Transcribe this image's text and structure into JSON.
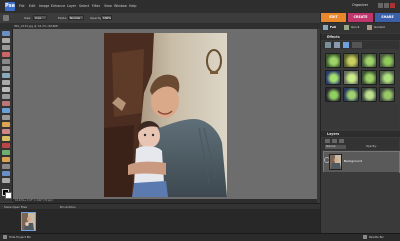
{
  "menubar": {
    "items": [
      "File",
      "Edit",
      "Image",
      "Enhance",
      "Layer",
      "Select",
      "Filter",
      "View",
      "Window",
      "Help"
    ],
    "organizer": "Organizer"
  },
  "options": {
    "size_label": "Size:",
    "size_value": "2 px",
    "mode_label": "Mode:",
    "mode_value": "Normal",
    "opacity_label": "Opacity:",
    "opacity_value": "100%"
  },
  "tabs": {
    "edit": "EDIT",
    "create": "CREATE",
    "share": "SHARE"
  },
  "subtabs": {
    "full": "Full",
    "quick": "Quick",
    "guided": "Guided"
  },
  "document": {
    "tab_title": "IMG_0134.jpg @ 16.4% (RGB/8)"
  },
  "status": {
    "text": "16.42% ▸ 3.47\" x 4.62\" (72 ppi)"
  },
  "bin": {
    "show_open_files": "Show Open Files",
    "bin_actions": "Bin Actions"
  },
  "bottom": {
    "hide_project_bin": "Hide Project Bin",
    "palette_bin": "Palette Bin"
  },
  "panels": {
    "effects_title": "Effects",
    "layers_title": "Layers",
    "layer_mode": "Normal",
    "layer_opacity_label": "Opacity:",
    "layer_name": "Background"
  },
  "colors": {
    "edit_tab": "#e8872b",
    "create_tab": "#c0356c",
    "share_tab": "#3b5fa8",
    "accent": "#6fa0e0"
  }
}
